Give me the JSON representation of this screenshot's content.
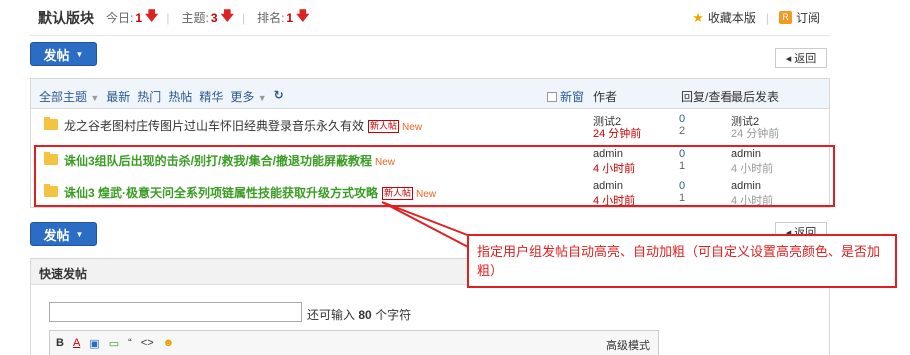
{
  "header": {
    "title": "默认版块",
    "today_label": "今日:",
    "today_value": "1",
    "topics_label": "主题:",
    "topics_value": "3",
    "rank_label": "排名:",
    "rank_value": "1",
    "sep": "|",
    "favorite_label": "收藏本版",
    "subscribe_label": "订阅",
    "rss_icon_text": "R"
  },
  "toolbar": {
    "post_label": "发帖",
    "back_label": "返回"
  },
  "thread_list": {
    "filters": [
      "全部主题",
      "最新",
      "热门",
      "热帖",
      "精华",
      "更多"
    ],
    "newest_label": "新窗",
    "col_author": "作者",
    "col_reply": "回复/查看",
    "col_last": "最后发表",
    "rows": [
      {
        "title": "龙之谷老图村庄传图片过山车怀旧经典登录音乐永久有效",
        "tag": "新人帖",
        "new": "New",
        "author": "测试2",
        "author_time": "24 分钟前",
        "replies": "0",
        "views": "2",
        "last_user": "测试2",
        "last_time": "24 分钟前"
      },
      {
        "title": "诛仙3组队后出现的击杀/别打/救我/集合/撤退功能屏蔽教程",
        "new": "New",
        "author": "admin",
        "author_time": "4 小时前",
        "replies": "0",
        "views": "1",
        "last_user": "admin",
        "last_time": "4 小时前"
      },
      {
        "title": "诛仙3 煌武·极意天问全系列项链属性技能获取升级方式攻略",
        "tag": "新人帖",
        "new": "New",
        "author": "admin",
        "author_time": "4 小时前",
        "replies": "0",
        "views": "1",
        "last_user": "admin",
        "last_time": "4 小时前"
      }
    ]
  },
  "callout": {
    "text": "指定用户组发帖自动高亮、自动加粗（可自定义设置高亮颜色、是否加粗）"
  },
  "quick_post": {
    "title": "快速发帖",
    "remain_prefix": "还可输入",
    "remain_count": "80",
    "remain_suffix": "个字符",
    "editor_buttons": [
      "B",
      "A",
      "▣",
      "▭",
      "“",
      "<>",
      "☻"
    ],
    "advanced_label": "高级模式"
  },
  "colors": {
    "accent": "#2b6cc4",
    "highlight_title": "#3a9d23",
    "annotation": "#e02020"
  }
}
